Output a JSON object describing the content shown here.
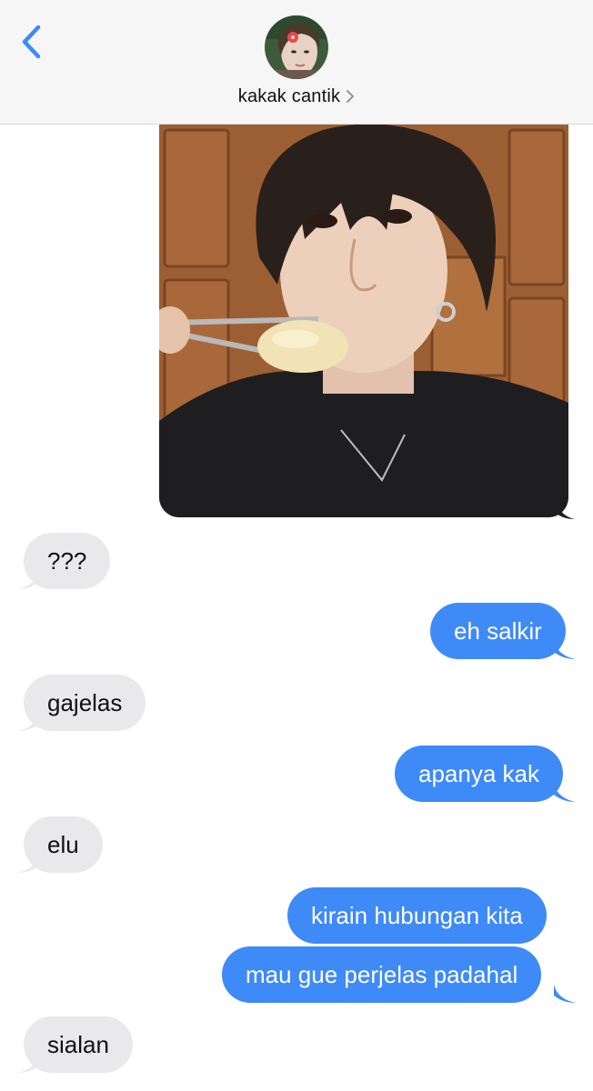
{
  "header": {
    "contact_name": "kakak cantik",
    "back_icon": "chevron-left-icon",
    "disclosure_icon": "chevron-right-icon"
  },
  "colors": {
    "accent": "#3e8af7",
    "incoming_bubble": "#e9e9eb",
    "header_bg": "#f6f6f6"
  },
  "messages": [
    {
      "direction": "outgoing",
      "type": "photo"
    },
    {
      "direction": "incoming",
      "text": "???"
    },
    {
      "direction": "outgoing",
      "text": "eh salkir"
    },
    {
      "direction": "incoming",
      "text": "gajelas"
    },
    {
      "direction": "outgoing",
      "text": "apanya kak"
    },
    {
      "direction": "incoming",
      "text": "elu"
    },
    {
      "direction": "outgoing",
      "text": "kirain hubungan kita"
    },
    {
      "direction": "outgoing",
      "text": "mau gue perjelas padahal"
    },
    {
      "direction": "incoming",
      "text": "sialan"
    }
  ]
}
